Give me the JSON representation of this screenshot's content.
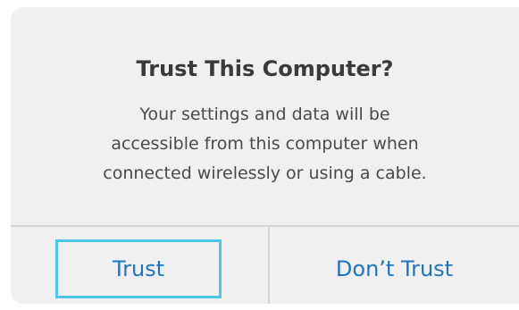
{
  "dialog": {
    "title": "Trust This Computer?",
    "message_lines": [
      "Your settings and data will be",
      "accessible from this computer when",
      "connected wirelessly or using a cable."
    ],
    "buttons": {
      "trust_label": "Trust",
      "dont_trust_label": "Don’t Trust"
    },
    "colors": {
      "background": "#f0f0f0",
      "button_text": "#1f73c4",
      "focus_ring": "#4ec6e6",
      "divider": "#d4d4d4"
    }
  }
}
